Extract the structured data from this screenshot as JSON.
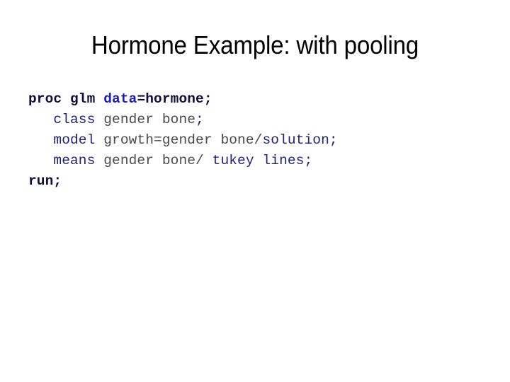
{
  "slide": {
    "title": "Hormone Example: with pooling",
    "background_color": "#ffffff"
  },
  "colors": {
    "navy_dark": "#0d0d3f",
    "blue": "#1a1ac4",
    "navy": "#20207a",
    "gray": "#4a4a4a",
    "title": "#000000"
  },
  "code": {
    "language": "SAS",
    "full_text": "proc glm data=hormone;\n   class gender bone;\n   model growth=gender bone/solution;\n   means gender bone/ tukey lines;\nrun;",
    "lines": [
      {
        "id": "line-1",
        "text": "proc glm data=hormone;",
        "tokens": [
          {
            "text": "proc glm ",
            "role": "navy_dark",
            "bold": true
          },
          {
            "text": "data",
            "role": "blue",
            "bold": true
          },
          {
            "text": "=hormone;",
            "role": "navy_dark",
            "bold": true
          }
        ]
      },
      {
        "id": "line-2",
        "text": "   class gender bone;",
        "tokens": [
          {
            "text": "   ",
            "role": "gray",
            "bold": false
          },
          {
            "text": "class",
            "role": "navy",
            "bold": false
          },
          {
            "text": " gender bone",
            "role": "gray",
            "bold": false
          },
          {
            "text": ";",
            "role": "navy",
            "bold": false
          }
        ]
      },
      {
        "id": "line-3",
        "text": "   model growth=gender bone/solution;",
        "tokens": [
          {
            "text": "   ",
            "role": "gray",
            "bold": false
          },
          {
            "text": "model",
            "role": "navy",
            "bold": false
          },
          {
            "text": " growth=gender bone/",
            "role": "gray",
            "bold": false
          },
          {
            "text": "solution;",
            "role": "navy",
            "bold": false
          }
        ]
      },
      {
        "id": "line-4",
        "text": "   means gender bone/ tukey lines;",
        "tokens": [
          {
            "text": "   ",
            "role": "gray",
            "bold": false
          },
          {
            "text": "means",
            "role": "navy",
            "bold": false
          },
          {
            "text": " gender bone/ ",
            "role": "gray",
            "bold": false
          },
          {
            "text": "tukey lines;",
            "role": "navy",
            "bold": false
          }
        ]
      },
      {
        "id": "line-5",
        "text": "run;",
        "tokens": [
          {
            "text": "run;",
            "role": "navy_dark",
            "bold": true
          }
        ]
      }
    ]
  }
}
